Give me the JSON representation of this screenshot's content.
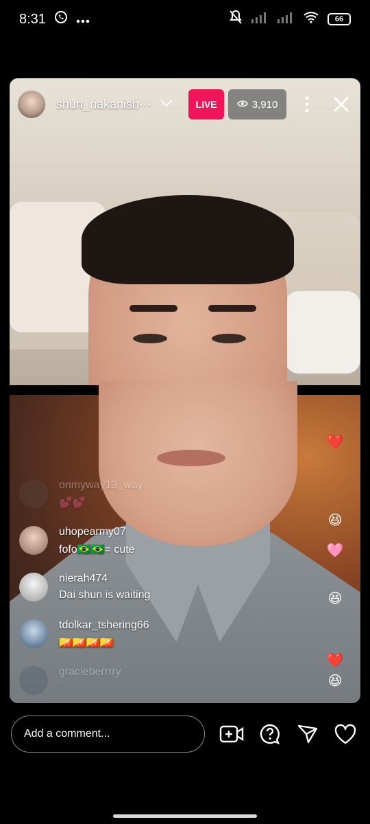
{
  "status_bar": {
    "time": "8:31",
    "battery": "66"
  },
  "live": {
    "username": "shun_nakanish···",
    "live_label": "LIVE",
    "viewer_count": "3,910"
  },
  "comments": [
    {
      "user": "onmyway13_way",
      "text": "💕💕",
      "faded": true
    },
    {
      "user": "uhopearmy07",
      "text": "fofo🇧🇷🇧🇷= cute"
    },
    {
      "user": "nierah474",
      "text": "Dai shun is waiting"
    },
    {
      "user": "tdolkar_tshering66",
      "text": "🇧🇹🇧🇹🇧🇹🇧🇹"
    },
    {
      "user": "gracieberrrry",
      "text": "",
      "faded": true
    }
  ],
  "reactions": [
    "❤️",
    "😆",
    "🩷",
    "😆",
    "❤️",
    "😆"
  ],
  "bottom": {
    "comment_placeholder": "Add a comment..."
  },
  "icons": {
    "notifications": "bell-off-icon",
    "whatsapp": "whatsapp-icon",
    "wifi": "wifi-icon",
    "signal": "signal-icon",
    "eye": "eye-icon",
    "add_guest": "video-add-icon",
    "question": "question-icon",
    "share": "send-icon",
    "like": "heart-icon"
  },
  "colors": {
    "live_badge": "#f0145a",
    "background": "#000000"
  }
}
